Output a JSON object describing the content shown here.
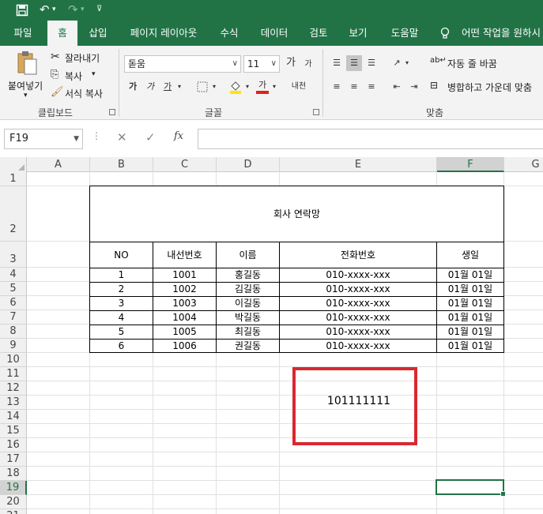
{
  "quick_access": {
    "save_icon": "save-icon",
    "undo_icon": "undo-icon",
    "redo_icon": "redo-icon",
    "customize_icon": "customize-icon"
  },
  "tabs": [
    {
      "label": "파일"
    },
    {
      "label": "홈"
    },
    {
      "label": "삽입"
    },
    {
      "label": "페이지 레이아웃"
    },
    {
      "label": "수식"
    },
    {
      "label": "데이터"
    },
    {
      "label": "검토"
    },
    {
      "label": "보기"
    },
    {
      "label": "도움말"
    },
    {
      "label": "어떤 작업을 원하시"
    }
  ],
  "ribbon": {
    "clipboard": {
      "paste": "붙여넣기",
      "cut": "잘라내기",
      "copy": "복사",
      "format_painter": "서식 복사",
      "group": "클립보드"
    },
    "font": {
      "name": "돋움",
      "size": "11",
      "grow": "가",
      "shrink": "가",
      "bold": "가",
      "italic": "가",
      "underline": "가",
      "font_color": "가",
      "phonetic": "내천",
      "group": "글꼴"
    },
    "alignment": {
      "wrap": "자동 줄 바꿈",
      "merge": "병합하고 가운데 맞춤",
      "group": "맞춤"
    }
  },
  "formula_bar": {
    "name_box": "F19",
    "fx": "fx",
    "value": ""
  },
  "sheet": {
    "columns": [
      "A",
      "B",
      "C",
      "D",
      "E",
      "F",
      "G"
    ],
    "rows": [
      "1",
      "2",
      "3",
      "4",
      "5",
      "6",
      "7",
      "8",
      "9",
      "10",
      "11",
      "12",
      "13",
      "14",
      "15",
      "16",
      "17",
      "18",
      "19",
      "20",
      "21"
    ],
    "table_title": "회사 연락망",
    "headers": [
      "NO",
      "내선번호",
      "이름",
      "전화번호",
      "생일"
    ],
    "records": [
      [
        "1",
        "1001",
        "홍길동",
        "010-xxxx-xxx",
        "01월 01일"
      ],
      [
        "2",
        "1002",
        "김길동",
        "010-xxxx-xxx",
        "01월 01일"
      ],
      [
        "3",
        "1003",
        "이길동",
        "010-xxxx-xxx",
        "01월 01일"
      ],
      [
        "4",
        "1004",
        "박길동",
        "010-xxxx-xxx",
        "01월 01일"
      ],
      [
        "5",
        "1005",
        "최길동",
        "010-xxxx-xxx",
        "01월 01일"
      ],
      [
        "6",
        "1006",
        "권길동",
        "010-xxxx-xxx",
        "01월 01일"
      ]
    ],
    "highlight_value": "101111111",
    "highlight_color": "#d9282f",
    "accent_color": "#217346"
  }
}
